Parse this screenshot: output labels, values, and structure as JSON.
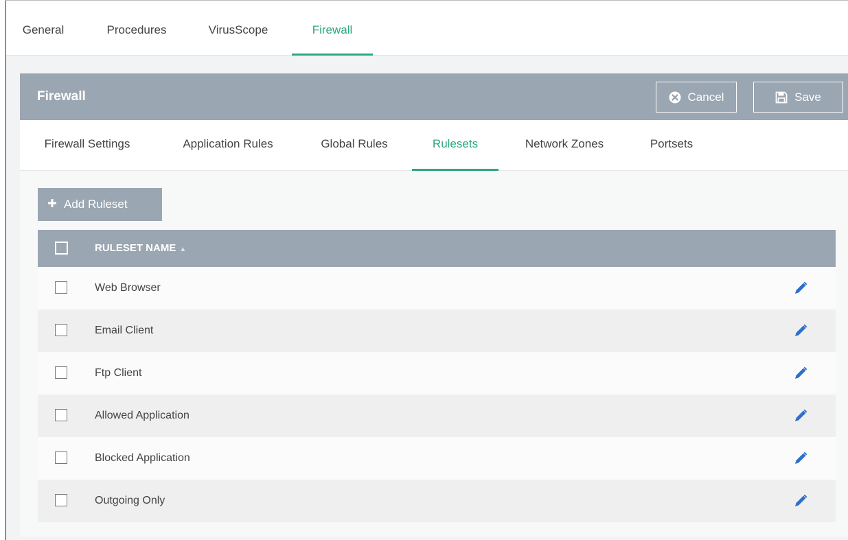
{
  "top_tabs": [
    "General",
    "Procedures",
    "VirusScope",
    "Firewall"
  ],
  "top_tabs_active": "Firewall",
  "panel": {
    "title": "Firewall",
    "cancel_label": "Cancel",
    "save_label": "Save"
  },
  "sub_tabs": [
    "Firewall Settings",
    "Application Rules",
    "Global Rules",
    "Rulesets",
    "Network Zones",
    "Portsets"
  ],
  "sub_tabs_active": "Rulesets",
  "add_button_label": "Add Ruleset",
  "table": {
    "column_header": "RULESET NAME",
    "rows": [
      "Web Browser",
      "Email Client",
      "Ftp Client",
      "Allowed Application",
      "Blocked Application",
      "Outgoing Only"
    ]
  },
  "colors": {
    "accent": "#2aa880",
    "header_bg": "#9aa6b1",
    "edit_icon": "#2f6fcb"
  },
  "icons": {
    "cancel": "x-circle-icon",
    "save": "floppy-disk-icon",
    "add": "plus-icon",
    "sort": "sort-icon",
    "edit": "pencil-icon"
  }
}
